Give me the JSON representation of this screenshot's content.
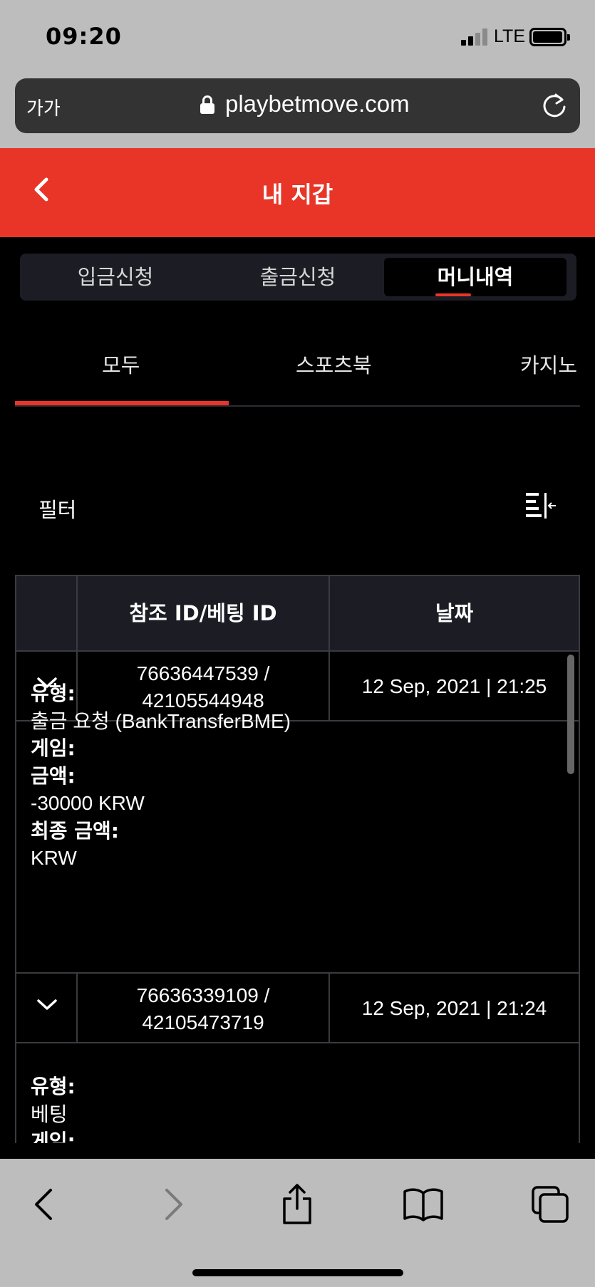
{
  "status_bar": {
    "time": "09:20",
    "network": "LTE"
  },
  "browser": {
    "aa_label": "가가",
    "url": "playbetmove.com"
  },
  "header": {
    "title": "내 지갑"
  },
  "segment_tabs": [
    {
      "label": "입금신청",
      "active": false
    },
    {
      "label": "출금신청",
      "active": false
    },
    {
      "label": "머니내역",
      "active": true
    }
  ],
  "category_tabs": [
    {
      "label": "모두",
      "active": true
    },
    {
      "label": "스포츠북",
      "active": false
    },
    {
      "label": "카지노",
      "active": false
    }
  ],
  "filter": {
    "label": "필터"
  },
  "table": {
    "columns": [
      "참조 ID/베팅 ID",
      "날짜"
    ],
    "rows": [
      {
        "ref_id": "76636447539 /",
        "bet_id": "42105544948",
        "date": "12 Sep, 2021 | 21:25",
        "expanded": true,
        "details": [
          {
            "label": "유형:",
            "value": "출금 요청 (BankTransferBME)"
          },
          {
            "label": "게임:",
            "value": ""
          },
          {
            "label": "금액:",
            "value": "-30000 KRW"
          },
          {
            "label": "최종 금액:",
            "value": "KRW"
          }
        ]
      },
      {
        "ref_id": "76636339109 /",
        "bet_id": "42105473719",
        "date": "12 Sep, 2021 | 21:24",
        "expanded": true,
        "details": [
          {
            "label": "유형:",
            "value": "베팅"
          },
          {
            "label": "게임:",
            "value": ""
          }
        ]
      }
    ]
  },
  "colors": {
    "accent": "#e83528",
    "panel": "#1c1d24",
    "border": "#3a3b40",
    "chrome": "#bdbdbd"
  }
}
